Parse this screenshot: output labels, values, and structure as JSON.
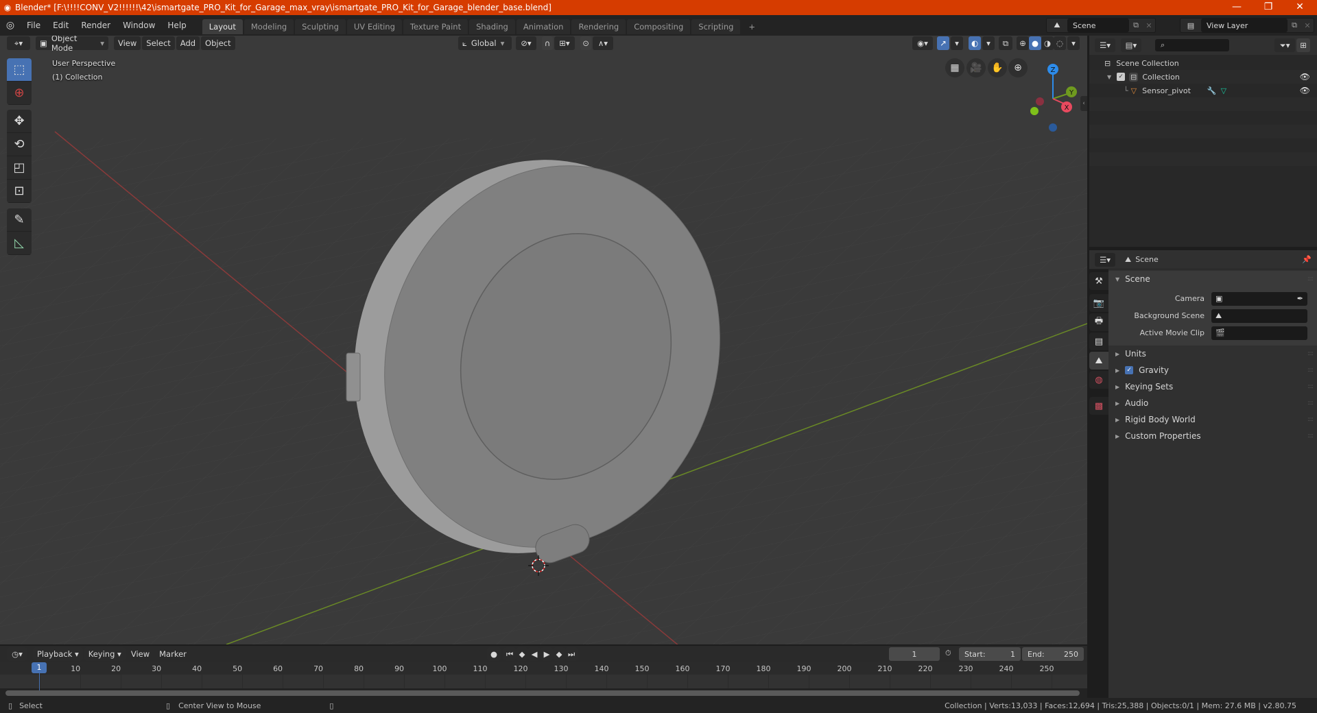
{
  "window": {
    "title": "Blender* [F:\\!!!!CONV_V2!!!!!!\\42\\ismartgate_PRO_Kit_for_Garage_max_vray\\ismartgate_PRO_Kit_for_Garage_blender_base.blend]",
    "controls": {
      "minimize": "—",
      "maximize": "❐",
      "close": "✕"
    }
  },
  "topbar": {
    "menus": [
      "File",
      "Edit",
      "Render",
      "Window",
      "Help"
    ],
    "workspaces": [
      "Layout",
      "Modeling",
      "Sculpting",
      "UV Editing",
      "Texture Paint",
      "Shading",
      "Animation",
      "Rendering",
      "Compositing",
      "Scripting"
    ],
    "active_workspace": "Layout",
    "add_workspace": "+",
    "scene": "Scene",
    "view_layer": "View Layer"
  },
  "viewport": {
    "mode": "Object Mode",
    "menus": [
      "View",
      "Select",
      "Add",
      "Object"
    ],
    "transform_orientation": "Global",
    "overlay_text": [
      "User Perspective",
      "(1) Collection"
    ],
    "gizmo_axes": {
      "x": "X",
      "y": "Y",
      "z": "Z"
    },
    "colors": {
      "x_axis": "#e84a5f",
      "y_axis": "#6f9a1f",
      "z_axis": "#2d8ceb",
      "grid_x_line": "#8a3a3a",
      "grid_y_line": "#6a8a25"
    }
  },
  "outliner": {
    "search_placeholder": "",
    "items": [
      {
        "label": "Scene Collection",
        "depth": 0
      },
      {
        "label": "Collection",
        "depth": 1,
        "checked": true,
        "visible": true
      },
      {
        "label": "Sensor_pivot",
        "depth": 2,
        "visible": true
      }
    ]
  },
  "properties": {
    "header_context": "Scene",
    "panel_title": "Scene",
    "fields": [
      {
        "label": "Camera",
        "value": ""
      },
      {
        "label": "Background Scene",
        "value": ""
      },
      {
        "label": "Active Movie Clip",
        "value": ""
      }
    ],
    "subpanels": [
      {
        "label": "Units"
      },
      {
        "label": "Gravity",
        "checkbox": true
      },
      {
        "label": "Keying Sets"
      },
      {
        "label": "Audio"
      },
      {
        "label": "Rigid Body World"
      },
      {
        "label": "Custom Properties"
      }
    ]
  },
  "timeline": {
    "menus": [
      "Playback",
      "Keying",
      "View",
      "Marker"
    ],
    "current_frame": "1",
    "start_label": "Start:",
    "start": "1",
    "end_label": "End:",
    "end": "250",
    "frame_ticks": [
      "10",
      "20",
      "30",
      "40",
      "50",
      "60",
      "70",
      "80",
      "90",
      "100",
      "110",
      "120",
      "130",
      "140",
      "150",
      "160",
      "170",
      "180",
      "190",
      "200",
      "210",
      "220",
      "230",
      "240",
      "250"
    ],
    "playhead": "1"
  },
  "statusbar": {
    "left_hint": "Select",
    "middle_hint": "Center View to Mouse",
    "stats": "Collection | Verts:13,033 | Faces:12,694 | Tris:25,388 | Objects:0/1 | Mem: 27.6 MB | v2.80.75"
  }
}
